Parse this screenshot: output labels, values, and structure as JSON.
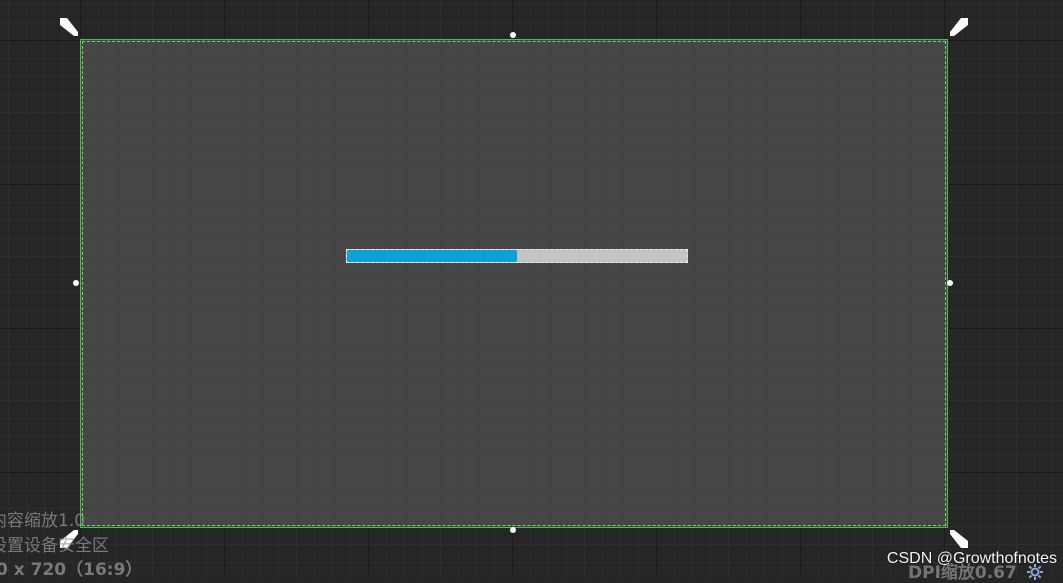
{
  "overlay": {
    "content_scale": "内容缩放1.0",
    "safe_zone": "设置设备安全区",
    "resolution": "0 x 720（16:9）",
    "dpi_scale": "DPI缩放0.67"
  },
  "watermark": "CSDN @Growthofnotes",
  "progress_bar": {
    "percent": 0.5,
    "fill_color": "#0aa0d8",
    "background_color": "#c4c4c4"
  },
  "colors": {
    "canvas_border": "#2bd62b",
    "canvas_fill": "#464646",
    "viewport_bg": "#262626"
  },
  "icons": {
    "anchor": "anchor-handle-icon",
    "settings": "gear-icon"
  }
}
